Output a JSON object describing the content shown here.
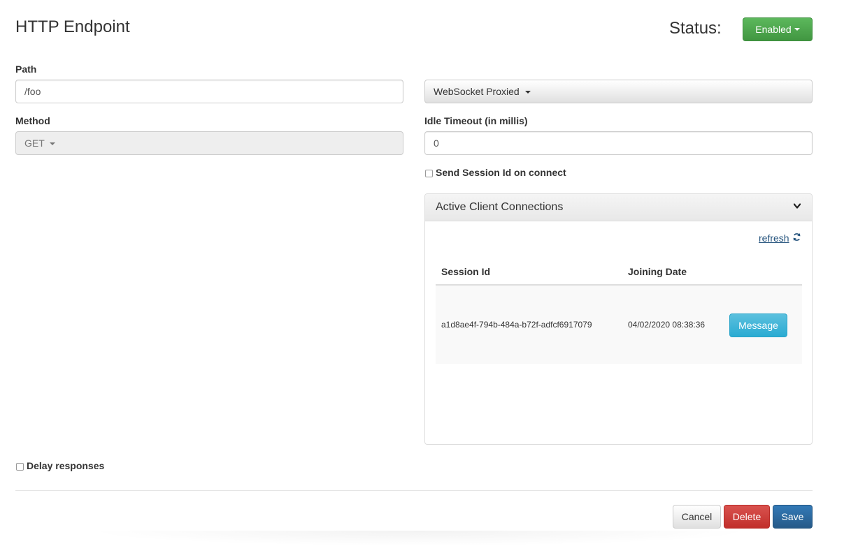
{
  "header": {
    "title": "HTTP Endpoint",
    "status_label": "Status:",
    "status_value": "Enabled"
  },
  "form": {
    "path_label": "Path",
    "path_value": "/foo",
    "method_label": "Method",
    "method_value": "GET",
    "mode_value": "WebSocket Proxied",
    "idle_timeout_label": "Idle Timeout (in millis)",
    "idle_timeout_value": "0",
    "send_session_id_label": "Send Session Id on connect",
    "delay_responses_label": "Delay responses"
  },
  "connections": {
    "title": "Active Client Connections",
    "refresh_label": "refresh",
    "columns": [
      "Session Id",
      "Joining Date"
    ],
    "rows": [
      {
        "session_id": "a1d8ae4f-794b-484a-b72f-adfcf6917079",
        "joining_date": "04/02/2020 08:38:36",
        "action_label": "Message"
      }
    ]
  },
  "footer": {
    "cancel_label": "Cancel",
    "delete_label": "Delete",
    "save_label": "Save"
  },
  "colors": {
    "enabled_green": "#4cae4c",
    "info_blue": "#31b0d5",
    "danger_red": "#d9534f",
    "primary_blue": "#286090",
    "link_blue": "#23527c"
  },
  "icons": {
    "chevron": "chevron-down-icon",
    "refresh": "refresh-icon",
    "caret": "caret-down-icon"
  }
}
